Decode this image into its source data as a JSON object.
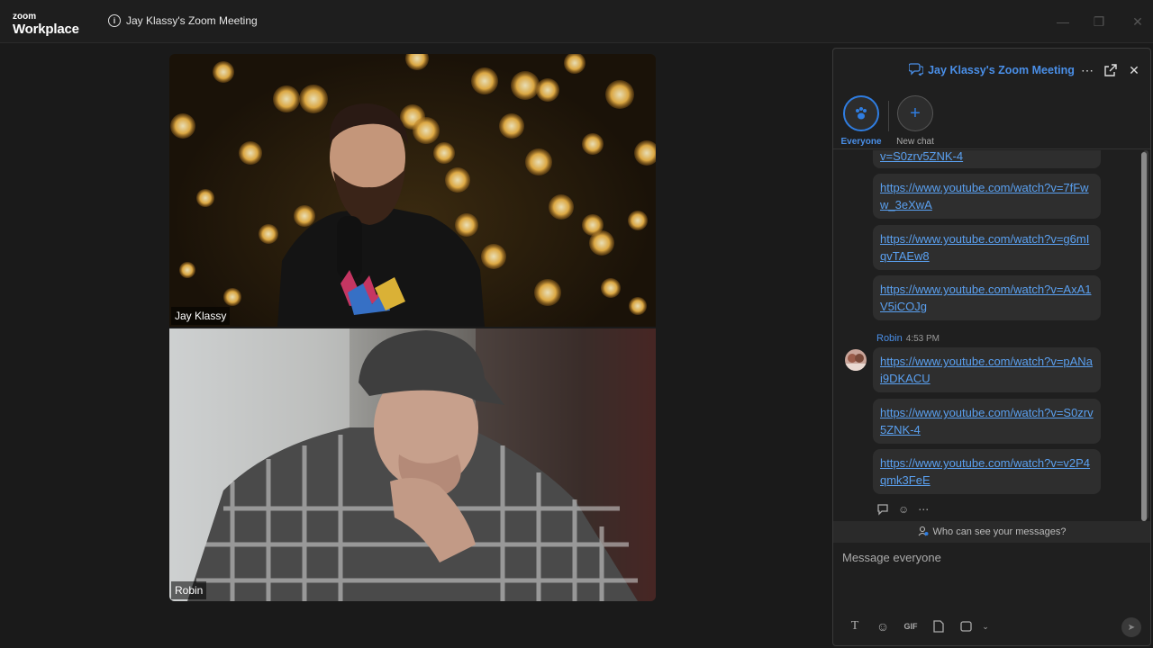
{
  "titlebar": {
    "logo_line1": "zoom",
    "logo_line2": "Workplace",
    "meeting_title": "Jay Klassy's Zoom Meeting"
  },
  "participants": [
    {
      "name": "Jay Klassy"
    },
    {
      "name": "Robin"
    }
  ],
  "chat": {
    "title": "Jay Klassy's Zoom Meeting",
    "tabs": [
      {
        "label": "Everyone",
        "icon": "paw-icon"
      },
      {
        "label": "New chat",
        "icon": "plus-icon"
      }
    ],
    "partial_top": "v=S0zrv5ZNK-4",
    "messages_prev": [
      "https://www.youtube.com/watch?v=7fFww_3eXwA",
      "https://www.youtube.com/watch?v=g6mIqvTAEw8",
      "https://www.youtube.com/watch?v=AxA1V5iCOJg"
    ],
    "robin_group": {
      "sender": "Robin",
      "time": "4:53 PM",
      "messages": [
        "https://www.youtube.com/watch?v=pANai9DKACU",
        "https://www.youtube.com/watch?v=S0zrv5ZNK-4",
        "https://www.youtube.com/watch?v=v2P4qmk3FeE"
      ]
    },
    "privacy_text": "Who can see your messages?",
    "compose_placeholder": "Message everyone"
  },
  "colors": {
    "accent": "#2f7de1",
    "link": "#5aa0f0",
    "panel_bg": "#1f1f1f"
  }
}
